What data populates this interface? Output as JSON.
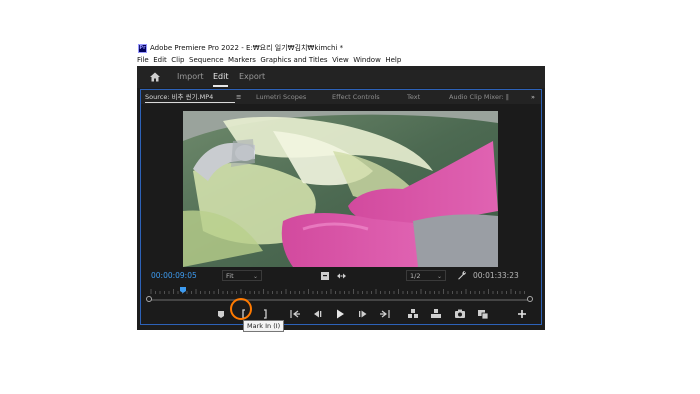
{
  "window": {
    "title": "Adobe Premiere Pro 2022 - E:₩요리 일기₩김치₩kimchi *",
    "logo_text": "Pr"
  },
  "menu": [
    "File",
    "Edit",
    "Clip",
    "Sequence",
    "Markers",
    "Graphics and Titles",
    "View",
    "Window",
    "Help"
  ],
  "header": {
    "tabs": [
      "Import",
      "Edit",
      "Export"
    ],
    "active_tab": "Edit"
  },
  "panel_tabs": {
    "source": "Source: 비추 씬기.MP4",
    "menu_glyph": "≡",
    "lumetri": "Lumetri Scopes",
    "effect_controls": "Effect Controls",
    "text": "Text",
    "audio_mixer": "Audio Clip Mixer: ‖",
    "overflow": "»"
  },
  "monitor": {
    "playhead_timecode": "00:00:09:05",
    "zoom": "Fit",
    "resolution": "1/2",
    "duration_timecode": "00:01:33:23"
  },
  "colors": {
    "accent_blue": "#3d9bf0",
    "highlight": "#ff7a00",
    "panel_border": "#2d62b8"
  },
  "tooltip": "Mark In (I)",
  "transport_icons": [
    "add-marker-icon",
    "mark-in-icon",
    "mark-out-icon",
    "go-to-in-icon",
    "step-back-icon",
    "play-icon",
    "step-forward-icon",
    "go-to-out-icon",
    "insert-icon",
    "overwrite-icon",
    "export-frame-icon",
    "button-editor-icon",
    "add-button-icon"
  ]
}
